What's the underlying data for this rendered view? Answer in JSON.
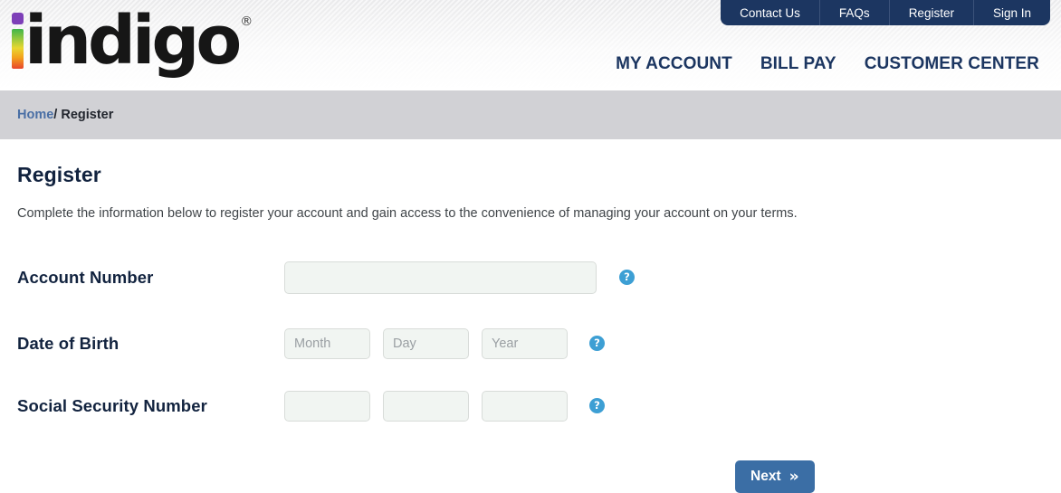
{
  "brand": {
    "name": "indigo",
    "trademark": "®"
  },
  "top_nav": {
    "items": [
      {
        "label": "Contact Us"
      },
      {
        "label": "FAQs"
      },
      {
        "label": "Register"
      },
      {
        "label": "Sign In"
      }
    ]
  },
  "main_nav": {
    "items": [
      {
        "label": "MY ACCOUNT"
      },
      {
        "label": "BILL PAY"
      },
      {
        "label": "CUSTOMER CENTER"
      }
    ]
  },
  "breadcrumb": {
    "home": "Home",
    "separator": "/",
    "current": "Register"
  },
  "page": {
    "title": "Register",
    "description": "Complete the information below to register your account and gain access to the convenience of managing your account on your terms."
  },
  "form": {
    "account_number": {
      "label": "Account Number",
      "value": "",
      "placeholder": "",
      "help": "?"
    },
    "date_of_birth": {
      "label": "Date of Birth",
      "month": {
        "value": "",
        "placeholder": "Month"
      },
      "day": {
        "value": "",
        "placeholder": "Day"
      },
      "year": {
        "value": "",
        "placeholder": "Year"
      },
      "help": "?"
    },
    "social_security_number": {
      "label": "Social Security Number",
      "part1": {
        "value": "",
        "placeholder": ""
      },
      "part2": {
        "value": "",
        "placeholder": ""
      },
      "part3": {
        "value": "",
        "placeholder": ""
      },
      "help": "?"
    },
    "next_button": {
      "label": "Next",
      "icon": "double-chevron-right",
      "glyph": "»"
    }
  },
  "colors": {
    "navy": "#1c3661",
    "breadcrumb_bg": "#d1d1d5",
    "link_blue": "#4a6fa5",
    "help_blue": "#3d9fd4",
    "button_blue": "#3b6ea5",
    "input_bg": "#f1f5f2"
  }
}
